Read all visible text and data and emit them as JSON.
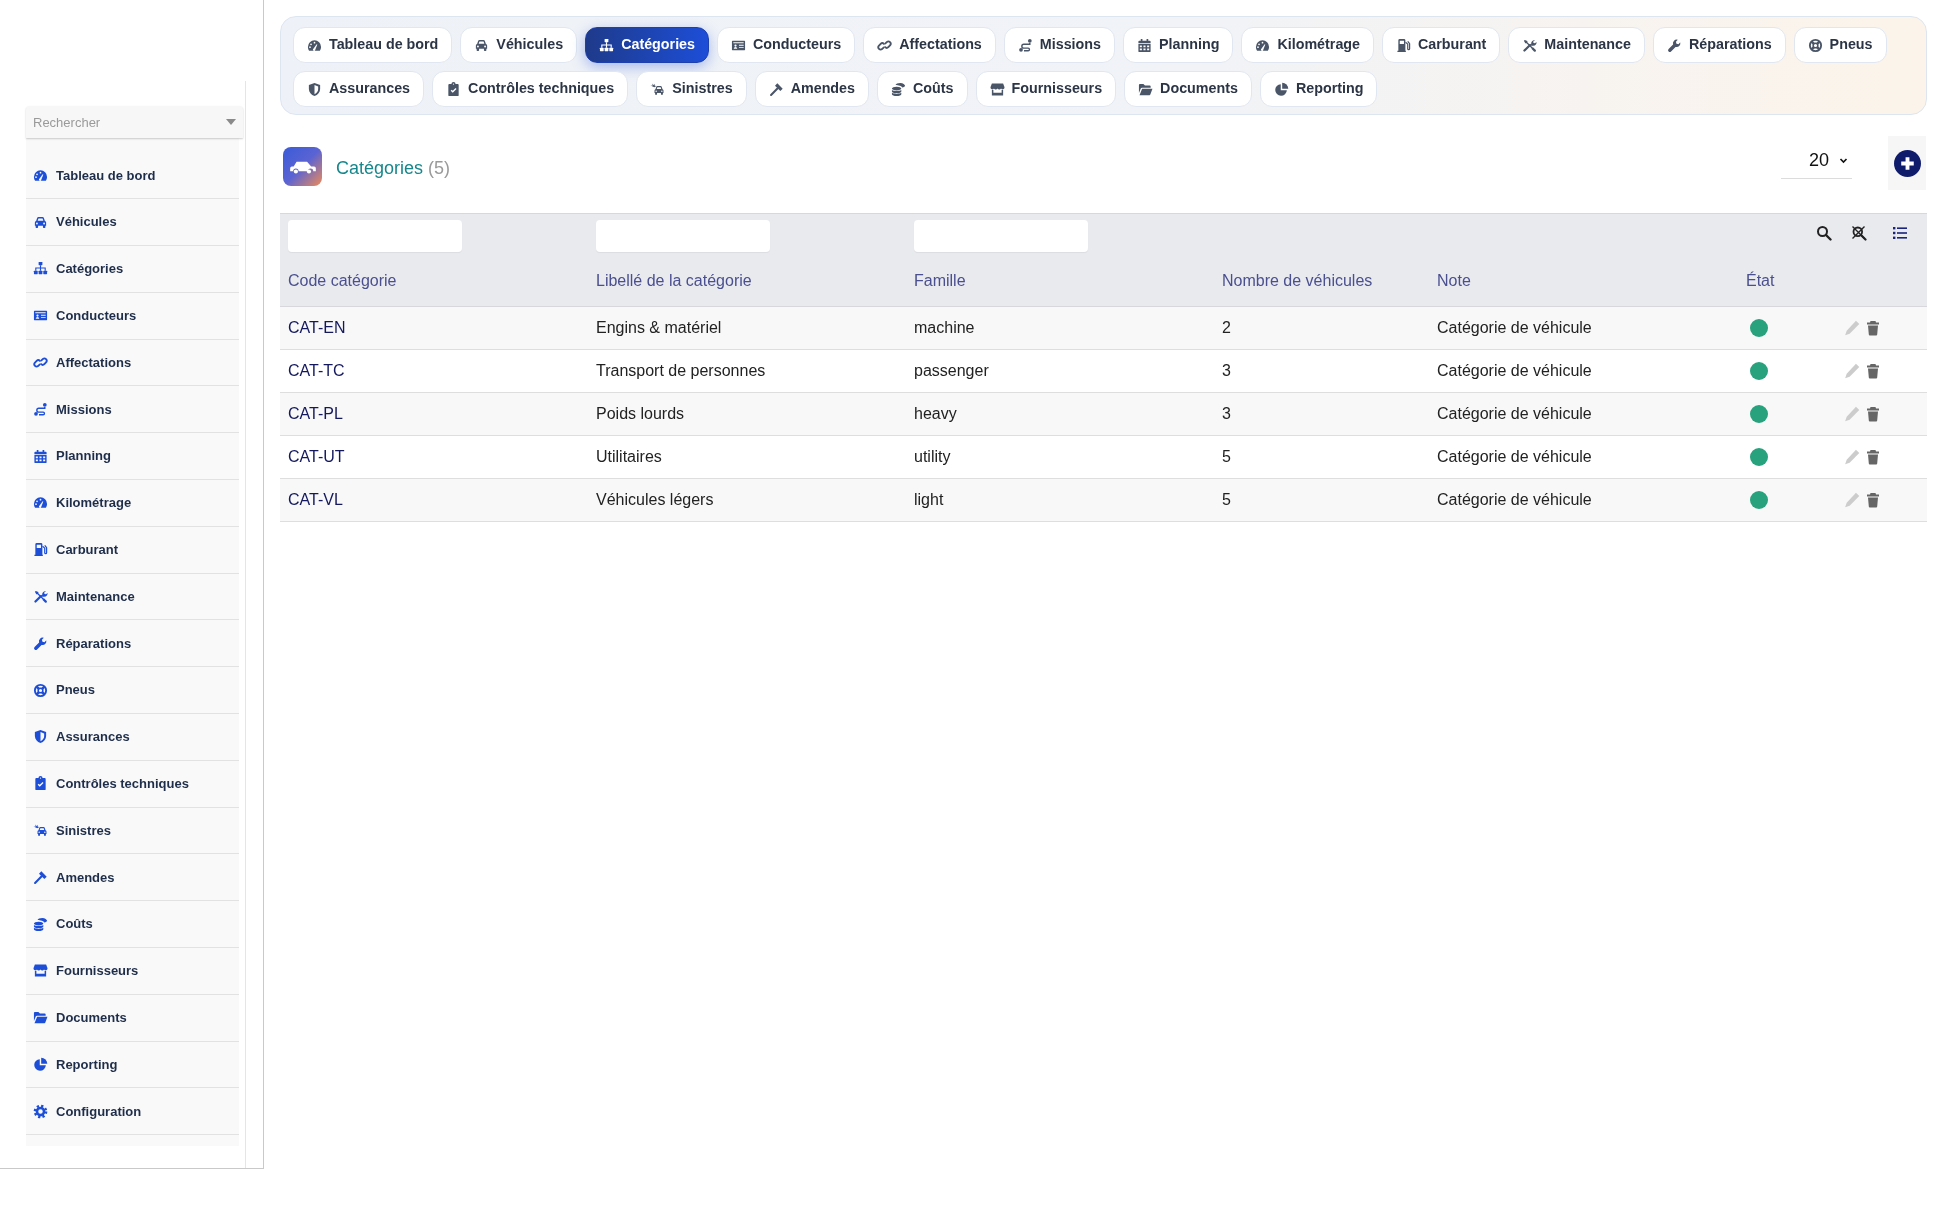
{
  "sidebar": {
    "search": {
      "placeholder": "Rechercher"
    },
    "items": [
      "Tableau de bord",
      "Véhicules",
      "Catégories",
      "Conducteurs",
      "Affectations",
      "Missions",
      "Planning",
      "Kilométrage",
      "Carburant",
      "Maintenance",
      "Réparations",
      "Pneus",
      "Assurances",
      "Contrôles techniques",
      "Sinistres",
      "Amendes",
      "Coûts",
      "Fournisseurs",
      "Documents",
      "Reporting",
      "Configuration"
    ]
  },
  "nav": {
    "rows": [
      {
        "tabs": [
          {
            "label": "Tableau de bord",
            "selected": false
          },
          {
            "label": "Véhicules",
            "selected": false
          },
          {
            "label": "Catégories",
            "selected": true
          },
          {
            "label": "Conducteurs",
            "selected": false
          },
          {
            "label": "Affectations",
            "selected": false
          },
          {
            "label": "Missions",
            "selected": false
          },
          {
            "label": "Planning",
            "selected": false
          },
          {
            "label": "Kilométrage",
            "selected": false
          },
          {
            "label": "Carburant",
            "selected": false
          },
          {
            "label": "Maintenance",
            "selected": false
          },
          {
            "label": "Réparations",
            "selected": false
          },
          {
            "label": "Pneus",
            "selected": false
          }
        ]
      },
      {
        "tabs": [
          {
            "label": "Assurances",
            "selected": false
          },
          {
            "label": "Contrôles techniques",
            "selected": false
          },
          {
            "label": "Sinistres",
            "selected": false
          },
          {
            "label": "Amendes",
            "selected": false
          },
          {
            "label": "Coûts",
            "selected": false
          },
          {
            "label": "Fournisseurs",
            "selected": false
          },
          {
            "label": "Documents",
            "selected": false
          },
          {
            "label": "Reporting",
            "selected": false
          }
        ]
      }
    ]
  },
  "header": {
    "title": "Catégories",
    "count": "(5)",
    "page_size": "20"
  },
  "table": {
    "columns": [
      {
        "label": "Code catégorie",
        "filterable": true
      },
      {
        "label": "Libellé de la catégorie",
        "filterable": true
      },
      {
        "label": "Famille",
        "filterable": true
      },
      {
        "label": "Nombre de véhicules",
        "filterable": false
      },
      {
        "label": "Note",
        "filterable": false
      },
      {
        "label": "État",
        "filterable": false
      }
    ],
    "rows": [
      {
        "cells": [
          "CAT-EN",
          "Engins & matériel",
          "machine",
          "2",
          "Catégorie de véhicule"
        ],
        "active": true
      },
      {
        "cells": [
          "CAT-TC",
          "Transport de personnes",
          "passenger",
          "3",
          "Catégorie de véhicule"
        ],
        "active": true
      },
      {
        "cells": [
          "CAT-PL",
          "Poids lourds",
          "heavy",
          "3",
          "Catégorie de véhicule"
        ],
        "active": true
      },
      {
        "cells": [
          "CAT-UT",
          "Utilitaires",
          "utility",
          "5",
          "Catégorie de véhicule"
        ],
        "active": true
      },
      {
        "cells": [
          "CAT-VL",
          "Véhicules légers",
          "light",
          "5",
          "Catégorie de véhicule"
        ],
        "active": true
      }
    ]
  }
}
